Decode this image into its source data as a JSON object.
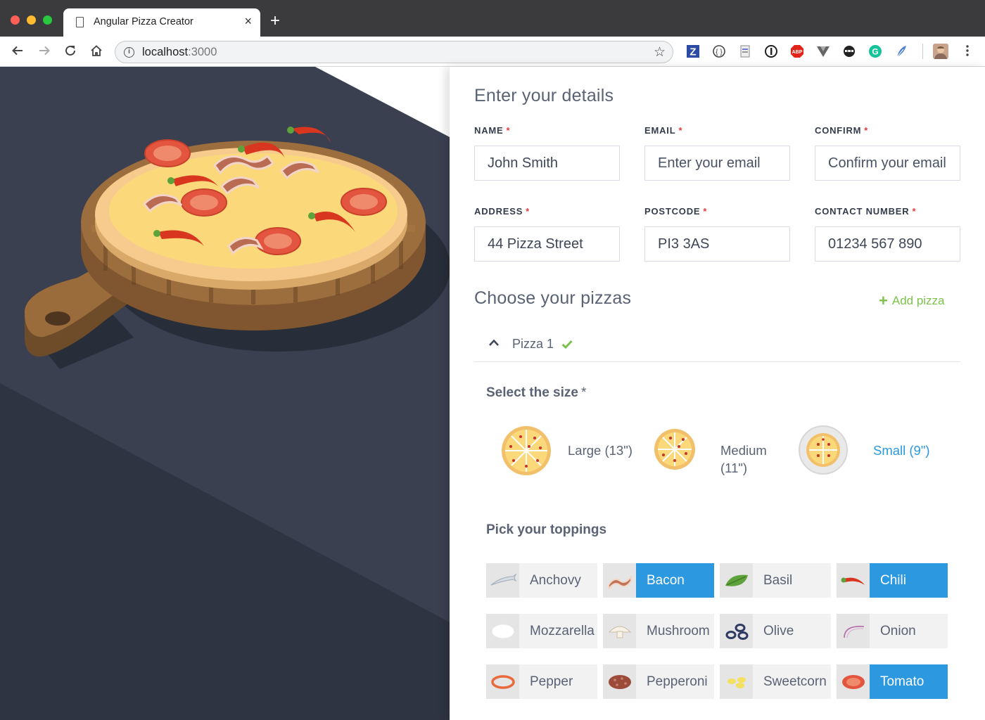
{
  "browser": {
    "tab_title": "Angular Pizza Creator",
    "tab_close": "×",
    "new_tab": "+",
    "url_host": "localhost",
    "url_port": ":3000",
    "extensions": [
      "z-extension-icon",
      "code-extension-icon",
      "page-extension-icon",
      "onepassword-icon",
      "adblock-plus-icon",
      "vue-devtools-icon",
      "ninja-extension-icon",
      "grammarly-icon",
      "feather-extension-icon",
      "profile-avatar"
    ]
  },
  "form": {
    "details_title": "Enter your details",
    "required_mark": "*",
    "fields": {
      "name": {
        "label": "NAME",
        "value": "John Smith",
        "placeholder": ""
      },
      "email": {
        "label": "EMAIL",
        "value": "",
        "placeholder": "Enter your email"
      },
      "confirm": {
        "label": "CONFIRM",
        "value": "",
        "placeholder": "Confirm your email"
      },
      "address": {
        "label": "ADDRESS",
        "value": "44 Pizza Street",
        "placeholder": ""
      },
      "postcode": {
        "label": "POSTCODE",
        "value": "PI3 3AS",
        "placeholder": ""
      },
      "contact": {
        "label": "CONTACT NUMBER",
        "value": "01234 567 890",
        "placeholder": ""
      }
    },
    "pizzas_title": "Choose your pizzas",
    "add_pizza": "Add pizza",
    "pizza": {
      "name": "Pizza 1",
      "valid": true,
      "size_title": "Select the size",
      "sizes": [
        {
          "label": "Large (13\")",
          "selected": false
        },
        {
          "label": "Medium (11\")",
          "selected": false
        },
        {
          "label": "Small (9\")",
          "selected": true
        }
      ],
      "toppings_title": "Pick your toppings",
      "toppings": [
        {
          "label": "Anchovy",
          "selected": false,
          "icon": "anchovy-icon"
        },
        {
          "label": "Bacon",
          "selected": true,
          "icon": "bacon-icon"
        },
        {
          "label": "Basil",
          "selected": false,
          "icon": "basil-icon"
        },
        {
          "label": "Chili",
          "selected": true,
          "icon": "chili-icon"
        },
        {
          "label": "Mozzarella",
          "selected": false,
          "icon": "mozzarella-icon"
        },
        {
          "label": "Mushroom",
          "selected": false,
          "icon": "mushroom-icon"
        },
        {
          "label": "Olive",
          "selected": false,
          "icon": "olive-icon"
        },
        {
          "label": "Onion",
          "selected": false,
          "icon": "onion-icon"
        },
        {
          "label": "Pepper",
          "selected": false,
          "icon": "pepper-icon"
        },
        {
          "label": "Pepperoni",
          "selected": false,
          "icon": "pepperoni-icon"
        },
        {
          "label": "Sweetcorn",
          "selected": false,
          "icon": "sweetcorn-icon"
        },
        {
          "label": "Tomato",
          "selected": true,
          "icon": "tomato-icon"
        }
      ]
    }
  },
  "colors": {
    "accent_blue": "#2b98e0",
    "accent_green": "#7cc24a",
    "required_red": "#e03e3e",
    "text": "#5a6274",
    "backdrop": "#2f3645"
  }
}
